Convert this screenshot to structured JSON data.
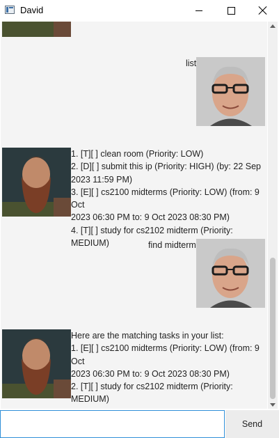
{
  "window": {
    "title": "David"
  },
  "messages": [
    {
      "sender": "user",
      "lines": [
        "list"
      ]
    },
    {
      "sender": "bot",
      "lines": [
        "1. [T][ ] clean room (Priority: LOW)",
        "2. [D][ ] submit this ip (Priority: HIGH) (by: 22 Sep",
        "2023 11:59 PM)",
        "3. [E][ ] cs2100 midterms (Priority: LOW) (from: 9 Oct",
        "2023 06:30 PM to: 9 Oct 2023 08:30 PM)",
        "4. [T][ ] study for cs2102 midterm (Priority: MEDIUM)"
      ]
    },
    {
      "sender": "user",
      "lines": [
        "find midterm"
      ]
    },
    {
      "sender": "bot",
      "lines": [
        "Here are the matching tasks in your list:",
        "1. [E][ ] cs2100 midterms (Priority: LOW) (from: 9 Oct",
        "2023 06:30 PM to: 9 Oct 2023 08:30 PM)",
        "2. [T][ ] study for cs2102 midterm (Priority: MEDIUM)"
      ]
    }
  ],
  "input": {
    "value": "",
    "placeholder": ""
  },
  "send_button": {
    "label": "Send"
  },
  "colors": {
    "input_focus_border": "#2f8fd8",
    "chat_background": "#f4f4f4"
  },
  "scrollbar": {
    "scroll_fraction": 1.0
  }
}
